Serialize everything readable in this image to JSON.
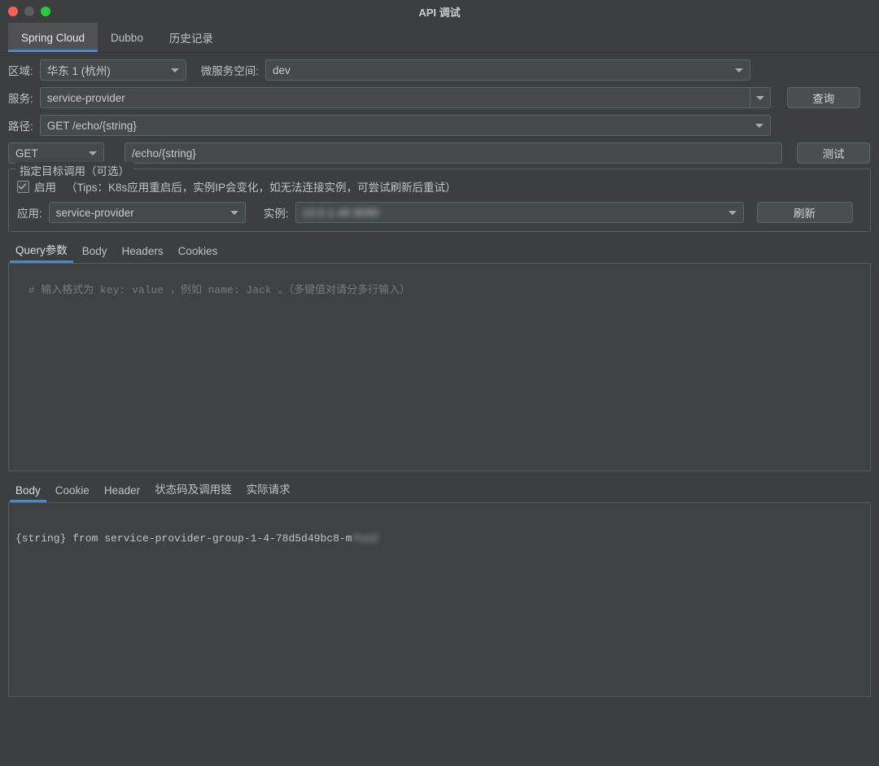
{
  "window": {
    "title": "API 调试",
    "controls": [
      "close",
      "minimize",
      "maximize"
    ]
  },
  "top_tabs": [
    {
      "label": "Spring Cloud",
      "active": true
    },
    {
      "label": "Dubbo",
      "active": false
    },
    {
      "label": "历史记录",
      "active": false
    }
  ],
  "form": {
    "region_label": "区域:",
    "region_value": "华东 1 (杭州)",
    "namespace_label": "微服务空间:",
    "namespace_value": "dev",
    "service_label": "服务:",
    "service_value": "service-provider",
    "query_button": "查询",
    "path_label": "路径:",
    "path_value": "GET  /echo/{string}",
    "method_value": "GET",
    "url_value": "/echo/{string}",
    "test_button": "测试"
  },
  "target_group": {
    "legend": "指定目标调用（可选）",
    "enable_label": "启用",
    "enable_checked": true,
    "tips": "（Tips：K8s应用重启后，实例IP会变化，如无法连接实例，可尝试刷新后重试）",
    "app_label": "应用:",
    "app_value": "service-provider",
    "instance_label": "实例:",
    "instance_value": "10.0.1.48  8080",
    "refresh_button": "刷新"
  },
  "request_tabs": [
    {
      "label": "Query参数",
      "active": true
    },
    {
      "label": "Body",
      "active": false
    },
    {
      "label": "Headers",
      "active": false
    },
    {
      "label": "Cookies",
      "active": false
    }
  ],
  "request_editor": {
    "placeholder": "# 输入格式为 key: value ，例如 name: Jack 。（多键值对请分多行输入）",
    "value": ""
  },
  "response_tabs": [
    {
      "label": "Body",
      "active": true
    },
    {
      "label": "Cookie",
      "active": false
    },
    {
      "label": "Header",
      "active": false
    },
    {
      "label": "状态码及调用链",
      "active": false
    },
    {
      "label": "实际请求",
      "active": false
    }
  ],
  "response": {
    "text": "{string} from service-provider-group-1-4-78d5d49bc8-m",
    "redacted_suffix": "7xz2"
  },
  "colors": {
    "background": "#3c3f41",
    "field_background": "#45494a",
    "border": "#5e6364",
    "accent": "#4a88c7",
    "text": "#bfc2c4",
    "close": "#ff5f57",
    "minimize": "#5a5d5f",
    "maximize": "#28c840"
  }
}
